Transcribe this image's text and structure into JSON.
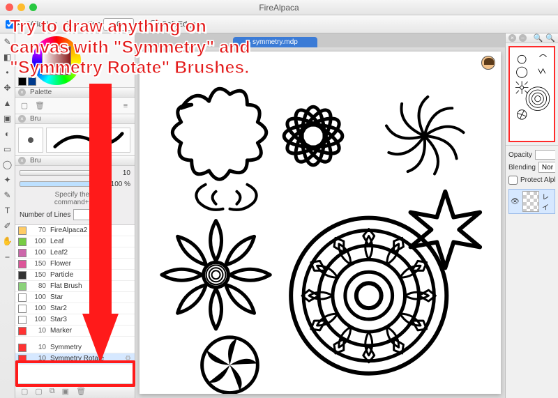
{
  "app": {
    "title": "FireAlpaca"
  },
  "instruction": "Try to draw anything on\ncanvas with \"Symmetry\" and\n\"Symmetry Rotate\" Brushes.",
  "options": {
    "antialias_label": "AntiAliasing",
    "antialias_checked": true,
    "correction_label": "Correction",
    "correction_value": "0",
    "softedge_label": "Soft Edge",
    "softedge_checked": false
  },
  "tab": {
    "filename": "symmetry.mdp"
  },
  "color": {
    "fg": "#9a1f1f",
    "swatch1": "#000000",
    "swatch2": "#003a8c"
  },
  "palette": {
    "label": "Palette"
  },
  "brush_preview": {
    "label": "Bru"
  },
  "brush_control": {
    "label": "Bru",
    "size_value": "10",
    "opacity_value": "100 %",
    "hint": "Specify the b\ncommand+Cl",
    "numlines_label": "Number of Lines",
    "numlines_value": ""
  },
  "brush_list_top": [
    {
      "sw": "#ffcc66",
      "size": "70",
      "name": "FireAlpaca2"
    },
    {
      "sw": "#77cc44",
      "size": "100",
      "name": "Leaf"
    },
    {
      "sw": "#cc66aa",
      "size": "100",
      "name": "Leaf2"
    },
    {
      "sw": "#dd5599",
      "size": "150",
      "name": "Flower"
    },
    {
      "sw": "#333",
      "size": "150",
      "name": "Particle"
    },
    {
      "sw": "#8bd27a",
      "size": "80",
      "name": "Flat Brush"
    },
    {
      "sw": "#fff",
      "size": "100",
      "name": "Star"
    },
    {
      "sw": "#fff",
      "size": "100",
      "name": "Star2"
    },
    {
      "sw": "#fff",
      "size": "100",
      "name": "Star3"
    },
    {
      "sw": "#ff3333",
      "size": "10",
      "name": "Marker"
    }
  ],
  "brush_list_highlight": [
    {
      "sw": "#ff3333",
      "size": "10",
      "name": "Symmetry"
    },
    {
      "sw": "#ff3333",
      "size": "10",
      "name": "Symmetry Rotate",
      "sel": true
    }
  ],
  "layer": {
    "opacity_label": "Opacity",
    "blending_label": "Blending",
    "blending_value": "Norm",
    "protect_label": "Protect Alpha",
    "layer_name": "レイ"
  }
}
